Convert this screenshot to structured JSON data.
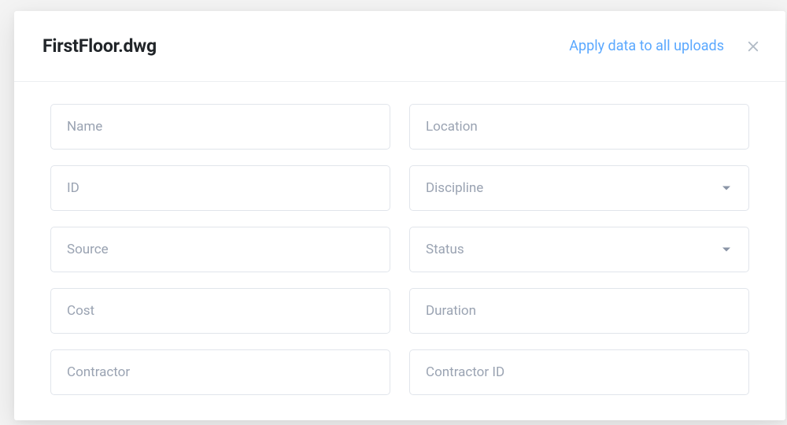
{
  "header": {
    "title": "FirstFloor.dwg",
    "apply_link": "Apply data to all uploads"
  },
  "fields": {
    "name": {
      "placeholder": "Name"
    },
    "location": {
      "placeholder": "Location"
    },
    "id": {
      "placeholder": "ID"
    },
    "discipline": {
      "placeholder": "Discipline"
    },
    "source": {
      "placeholder": "Source"
    },
    "status": {
      "placeholder": "Status"
    },
    "cost": {
      "placeholder": "Cost"
    },
    "duration": {
      "placeholder": "Duration"
    },
    "contractor": {
      "placeholder": "Contractor"
    },
    "contractor_id": {
      "placeholder": "Contractor ID"
    }
  }
}
